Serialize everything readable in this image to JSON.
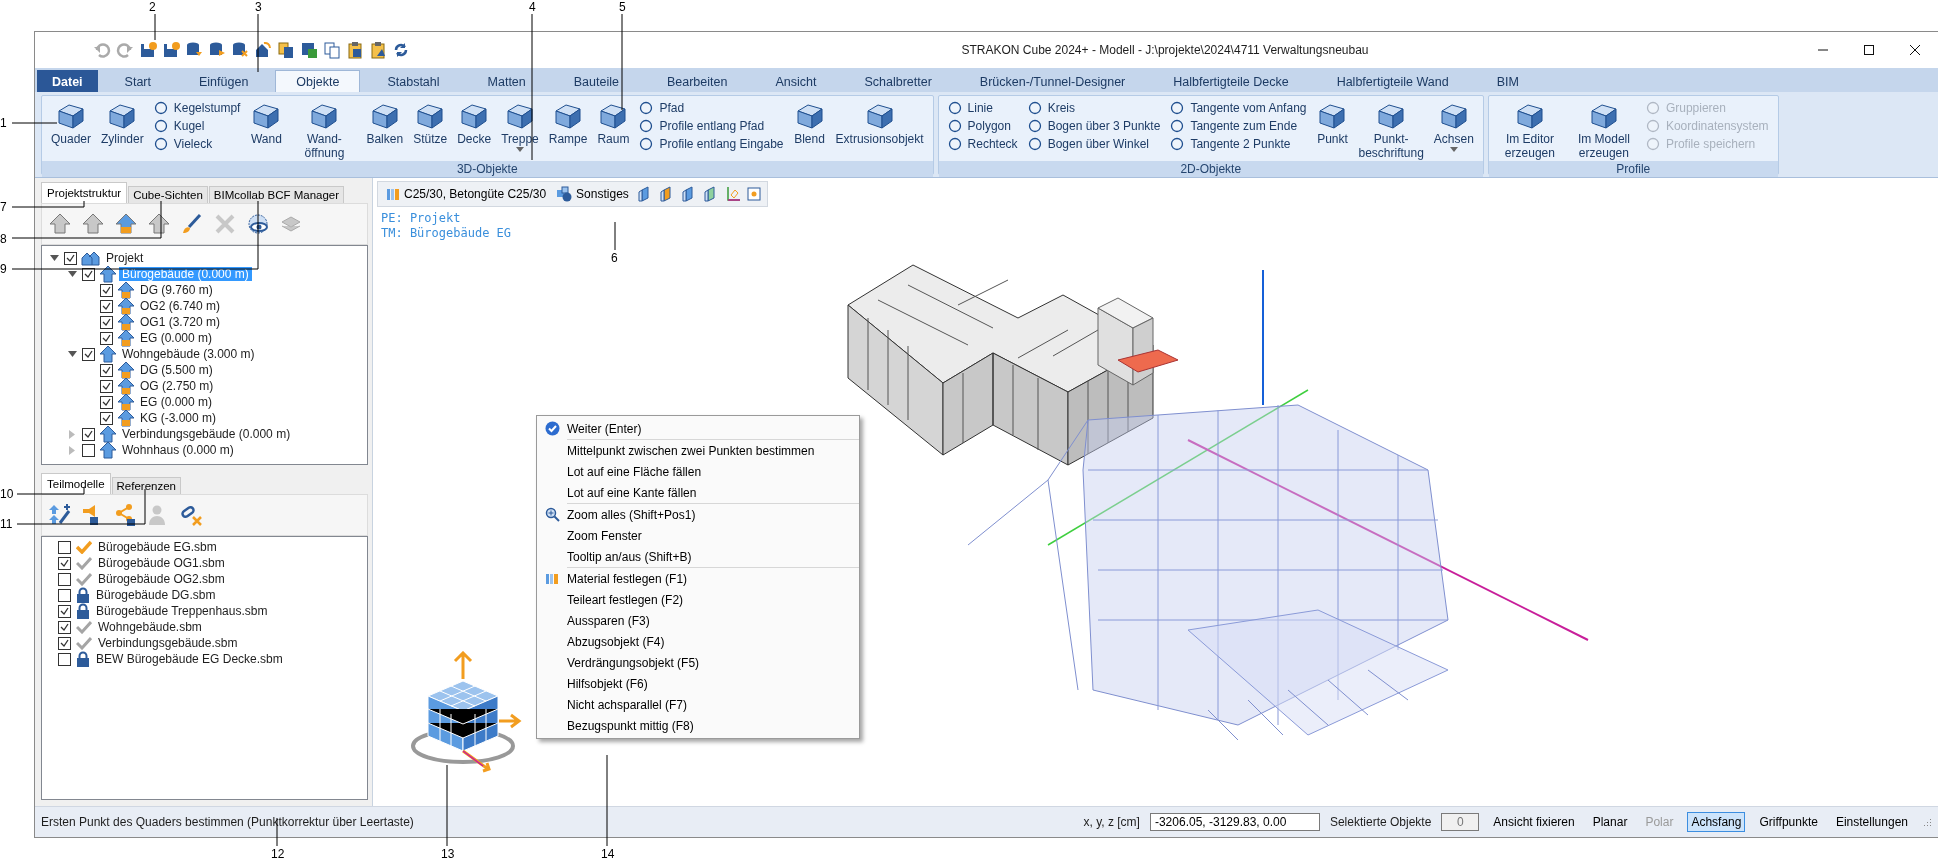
{
  "window": {
    "title": "STRAKON Cube 2024+ - Modell - J:\\projekte\\2024\\4711 Verwaltungsneubau"
  },
  "ribbon": {
    "tabs": [
      {
        "label": "Datei",
        "kind": "file",
        "selected": false
      },
      {
        "label": "Start",
        "kind": "tab",
        "selected": false
      },
      {
        "label": "Einfügen",
        "kind": "tab",
        "selected": false
      },
      {
        "label": "Objekte",
        "kind": "tab",
        "selected": true
      },
      {
        "label": "Stabstahl",
        "kind": "tab",
        "selected": false
      },
      {
        "label": "Matten",
        "kind": "tab",
        "selected": false
      },
      {
        "label": "Bauteile",
        "kind": "tab",
        "selected": false
      },
      {
        "label": "Bearbeiten",
        "kind": "tab",
        "selected": false
      },
      {
        "label": "Ansicht",
        "kind": "tab",
        "selected": false
      },
      {
        "label": "Schalbretter",
        "kind": "tab",
        "selected": false
      },
      {
        "label": "Brücken-/Tunnel-Designer",
        "kind": "tab",
        "selected": false
      },
      {
        "label": "Halbfertigteile Decke",
        "kind": "tab",
        "selected": false
      },
      {
        "label": "Halbfertigteile Wand",
        "kind": "tab",
        "selected": false
      },
      {
        "label": "BIM",
        "kind": "tab",
        "selected": false
      }
    ],
    "groups": [
      {
        "title": "3D-Objekte",
        "columns": [
          {
            "kind": "large",
            "label": "Quader",
            "dropdown": false
          },
          {
            "kind": "large",
            "label": "Zylinder",
            "dropdown": false
          },
          {
            "kind": "stack",
            "items": [
              {
                "label": "Kegelstumpf"
              },
              {
                "label": "Kugel"
              },
              {
                "label": "Vieleck"
              }
            ]
          },
          {
            "kind": "large",
            "label": "Wand",
            "dropdown": false
          },
          {
            "kind": "large",
            "label": "Wand-öffnung",
            "dropdown": false
          },
          {
            "kind": "large",
            "label": "Balken",
            "dropdown": false
          },
          {
            "kind": "large",
            "label": "Stütze",
            "dropdown": false
          },
          {
            "kind": "large",
            "label": "Decke",
            "dropdown": false
          },
          {
            "kind": "large",
            "label": "Treppe",
            "dropdown": true
          },
          {
            "kind": "large",
            "label": "Rampe",
            "dropdown": false
          },
          {
            "kind": "large",
            "label": "Raum",
            "dropdown": false
          },
          {
            "kind": "stack",
            "items": [
              {
                "label": "Pfad"
              },
              {
                "label": "Profile entlang Pfad"
              },
              {
                "label": "Profile entlang Eingabe"
              }
            ]
          },
          {
            "kind": "large",
            "label": "Blend",
            "dropdown": false
          },
          {
            "kind": "large",
            "label": "Extrusionsobjekt",
            "dropdown": false
          }
        ]
      },
      {
        "title": "2D-Objekte",
        "columns": [
          {
            "kind": "stack",
            "items": [
              {
                "label": "Linie"
              },
              {
                "label": "Polygon"
              },
              {
                "label": "Rechteck"
              }
            ]
          },
          {
            "kind": "stack",
            "items": [
              {
                "label": "Kreis"
              },
              {
                "label": "Bogen über 3 Punkte"
              },
              {
                "label": "Bogen über Winkel"
              }
            ]
          },
          {
            "kind": "stack",
            "items": [
              {
                "label": "Tangente vom Anfang"
              },
              {
                "label": "Tangente zum Ende"
              },
              {
                "label": "Tangente 2 Punkte"
              }
            ]
          },
          {
            "kind": "large",
            "label": "Punkt",
            "dropdown": false
          },
          {
            "kind": "large",
            "label": "Punkt-beschriftung",
            "dropdown": false
          },
          {
            "kind": "large",
            "label": "Achsen",
            "dropdown": true
          }
        ]
      },
      {
        "title": "Profile",
        "columns": [
          {
            "kind": "large",
            "label": "Im Editor erzeugen",
            "dropdown": false
          },
          {
            "kind": "large",
            "label": "Im Modell erzeugen",
            "dropdown": false
          },
          {
            "kind": "stack",
            "items": [
              {
                "label": "Gruppieren",
                "disabled": true
              },
              {
                "label": "Koordinatensystem",
                "disabled": true
              },
              {
                "label": "Profile speichern",
                "disabled": true
              }
            ]
          }
        ]
      }
    ]
  },
  "left_panel": {
    "tabs": [
      {
        "label": "Projektstruktur",
        "selected": true
      },
      {
        "label": "Cube-Sichten",
        "selected": false
      },
      {
        "label": "BIMcollab BCF Manager",
        "selected": false
      }
    ],
    "tree": [
      {
        "label": "Projekt",
        "kind": "project",
        "checked": true,
        "selected": false,
        "expanded": true,
        "children": [
          {
            "label": "Bürogebäude (0.000 m)",
            "kind": "building",
            "checked": true,
            "selected": true,
            "expanded": true,
            "children": [
              {
                "label": "DG (9.760 m)",
                "kind": "level",
                "checked": true,
                "selected": false
              },
              {
                "label": "OG2 (6.740 m)",
                "kind": "level",
                "checked": true,
                "selected": false
              },
              {
                "label": "OG1 (3.720 m)",
                "kind": "level",
                "checked": true,
                "selected": false
              },
              {
                "label": "EG (0.000 m)",
                "kind": "level",
                "checked": true,
                "selected": false
              }
            ]
          },
          {
            "label": "Wohngebäude (3.000 m)",
            "kind": "building",
            "checked": true,
            "selected": false,
            "expanded": true,
            "children": [
              {
                "label": "DG (5.500 m)",
                "kind": "level",
                "checked": true,
                "selected": false
              },
              {
                "label": "OG (2.750 m)",
                "kind": "level",
                "checked": true,
                "selected": false
              },
              {
                "label": "EG (0.000 m)",
                "kind": "level",
                "checked": true,
                "selected": false
              },
              {
                "label": "KG (-3.000 m)",
                "kind": "level",
                "checked": true,
                "selected": false
              }
            ]
          },
          {
            "label": "Verbindungsgebäude (0.000 m)",
            "kind": "building",
            "checked": true,
            "selected": false,
            "expanded": false
          },
          {
            "label": "Wohnhaus (0.000 m)",
            "kind": "building",
            "checked": false,
            "selected": false,
            "expanded": false
          }
        ]
      }
    ],
    "lower_tabs": [
      {
        "label": "Teilmodelle",
        "selected": true
      },
      {
        "label": "Referenzen",
        "selected": false
      }
    ],
    "submodels": [
      {
        "label": "Bürogebäude EG.sbm",
        "checked": false,
        "kind": "active"
      },
      {
        "label": "Bürogebäude OG1.sbm",
        "checked": true,
        "kind": "loaded"
      },
      {
        "label": "Bürogebäude OG2.sbm",
        "checked": false,
        "kind": "loaded"
      },
      {
        "label": "Bürogebäude DG.sbm",
        "checked": false,
        "kind": "locked"
      },
      {
        "label": "Bürogebäude Treppenhaus.sbm",
        "checked": true,
        "kind": "locked"
      },
      {
        "label": "Wohngebäude.sbm",
        "checked": true,
        "kind": "loaded"
      },
      {
        "label": "Verbindungsgebäude.sbm",
        "checked": true,
        "kind": "loaded"
      },
      {
        "label": "BEW Bürogebäude EG Decke.sbm",
        "checked": false,
        "kind": "locked"
      }
    ]
  },
  "canvas": {
    "toolbar": {
      "material": "C25/30, Betongüte C25/30",
      "part_type": "Sonstiges"
    },
    "info": [
      "PE: Projekt",
      "TM: Bürogebäude EG"
    ]
  },
  "context_menu": [
    [
      {
        "label": "Weiter (Enter)",
        "kind": "check"
      }
    ],
    [
      {
        "label": "Mittelpunkt zwischen zwei Punkten bestimmen"
      },
      {
        "label": "Lot auf eine Fläche fällen"
      },
      {
        "label": "Lot auf eine Kante fällen"
      }
    ],
    [
      {
        "label": "Zoom alles (Shift+Pos1)",
        "kind": "zoom"
      },
      {
        "label": "Zoom Fenster"
      },
      {
        "label": "Tooltip an/aus (Shift+B)"
      }
    ],
    [
      {
        "label": "Material festlegen (F1)",
        "kind": "material"
      },
      {
        "label": "Teileart festlegen (F2)"
      },
      {
        "label": "Aussparen (F3)"
      },
      {
        "label": "Abzugsobjekt (F4)"
      },
      {
        "label": "Verdrängungsobjekt (F5)"
      },
      {
        "label": "Hilfsobjekt (F6)"
      },
      {
        "label": "Nicht achsparallel (F7)"
      },
      {
        "label": "Bezugspunkt mittig (F8)"
      }
    ]
  ],
  "status_bar": {
    "message": "Ersten Punkt des Quaders bestimmen (Punktkorrektur über Leertaste)",
    "coord_label": "x, y, z [cm]",
    "coord_value": "-3206.05, -3129.83, 0.00",
    "selection_label": "Selektierte Objekte",
    "selection_count": "0",
    "toggles": [
      {
        "label": "Ansicht fixieren",
        "selected": false,
        "disabled": false
      },
      {
        "label": "Planar",
        "selected": false,
        "disabled": false
      },
      {
        "label": "Polar",
        "selected": false,
        "disabled": true
      },
      {
        "label": "Achsfang",
        "selected": true,
        "disabled": false
      },
      {
        "label": "Griffpunkte",
        "selected": false,
        "disabled": false
      },
      {
        "label": "Einstellungen",
        "selected": false,
        "disabled": false
      }
    ]
  },
  "callouts": [
    "1",
    "2",
    "3",
    "4",
    "5",
    "6",
    "7",
    "8",
    "9",
    "10",
    "11",
    "12",
    "13",
    "14"
  ]
}
